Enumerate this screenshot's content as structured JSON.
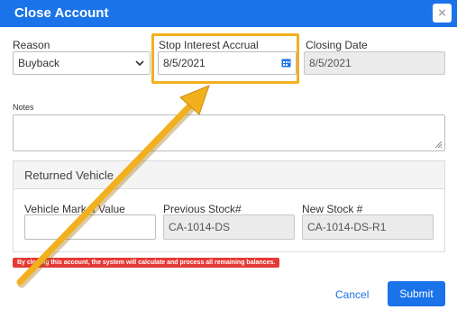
{
  "dialog": {
    "title": "Close Account",
    "close_glyph": "×"
  },
  "reason": {
    "label": "Reason",
    "value": "Buyback"
  },
  "stop_interest": {
    "label": "Stop Interest Accrual",
    "value": "8/5/2021"
  },
  "closing_date": {
    "label": "Closing Date",
    "value": "8/5/2021"
  },
  "notes": {
    "label": "Notes",
    "value": ""
  },
  "returned_vehicle": {
    "title": "Returned Vehicle",
    "market_value": {
      "label": "Vehicle Market Value",
      "value": ""
    },
    "previous_stock": {
      "label": "Previous Stock#",
      "value": "CA-1014-DS"
    },
    "new_stock": {
      "label": "New Stock #",
      "value": "CA-1014-DS-R1"
    }
  },
  "warning": "By closing this account, the system will calculate and process all remaining balances.",
  "buttons": {
    "cancel": "Cancel",
    "submit": "Submit"
  },
  "colors": {
    "primary": "#1a73e8",
    "highlight": "#f2b01e",
    "warning": "#e53935"
  }
}
